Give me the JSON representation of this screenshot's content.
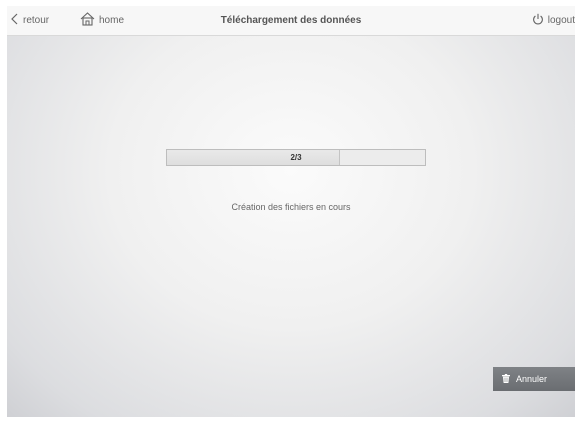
{
  "header": {
    "back_label": "retour",
    "home_label": "home",
    "title": "Téléchargement des données",
    "logout_label": "logout"
  },
  "progress": {
    "label": "2/3",
    "current": 2,
    "total": 3,
    "fraction": 0.667
  },
  "status": {
    "message": "Création des fichiers en cours"
  },
  "actions": {
    "cancel_label": "Annuler"
  },
  "icons": {
    "back": "chevron-left-icon",
    "home": "home-icon",
    "logout": "power-icon",
    "cancel": "trash-icon"
  },
  "colors": {
    "cancel_button_bg": "#737679",
    "text": "#666666"
  }
}
